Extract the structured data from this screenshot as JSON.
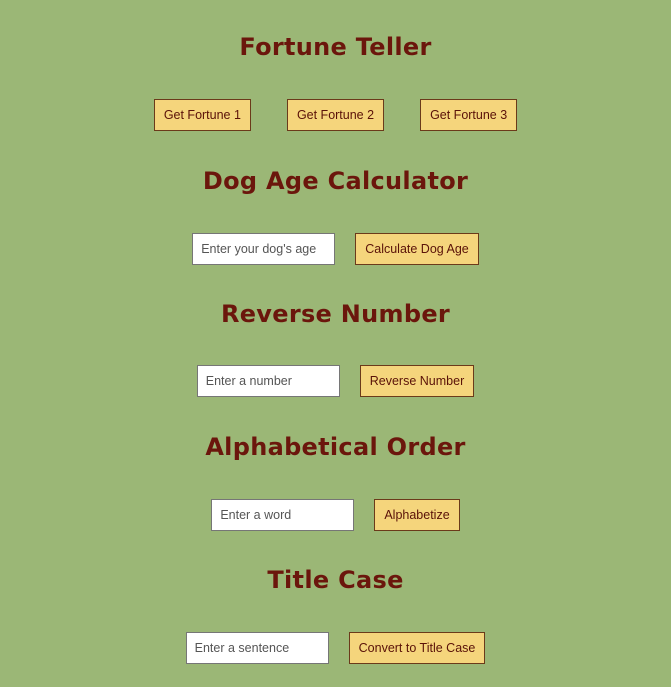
{
  "fortune": {
    "title": "Fortune Teller",
    "buttons": [
      "Get Fortune 1",
      "Get Fortune 2",
      "Get Fortune 3"
    ]
  },
  "dog_age": {
    "title": "Dog Age Calculator",
    "placeholder": "Enter your dog's age",
    "value": "",
    "button": "Calculate Dog Age"
  },
  "reverse": {
    "title": "Reverse Number",
    "placeholder": "Enter a number",
    "value": "",
    "button": "Reverse Number"
  },
  "alphabetical": {
    "title": "Alphabetical Order",
    "placeholder": "Enter a word",
    "value": "",
    "button": "Alphabetize"
  },
  "title_case": {
    "title": "Title Case",
    "placeholder": "Enter a sentence",
    "value": "",
    "button": "Convert to Title Case"
  },
  "colors": {
    "background": "#9bb776",
    "heading": "#6b160c",
    "button_bg": "#f5d57c"
  }
}
